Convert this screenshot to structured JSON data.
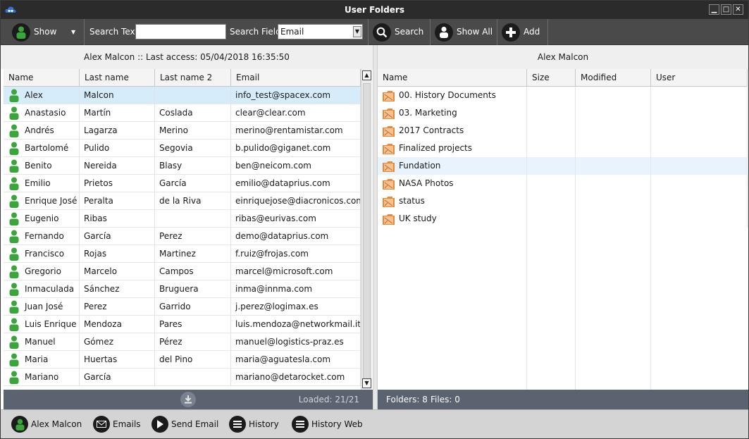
{
  "window": {
    "title": "User Folders"
  },
  "toolbar": {
    "show_label": "Show",
    "search_text_label": "Search Text",
    "search_text_value": "",
    "search_field_label": "Search Field",
    "search_field_value": "Email",
    "search_label": "Search",
    "show_all_label": "Show All",
    "add_label": "Add"
  },
  "left_pane": {
    "header": "Alex Malcon :: Last access: 05/04/2018 16:35:50",
    "columns": [
      "Name",
      "Last name",
      "Last name 2",
      "Email"
    ],
    "rows": [
      {
        "name": "Alex",
        "last": "Malcon",
        "last2": "",
        "email": "info_test@spacex.com"
      },
      {
        "name": "Anastasio",
        "last": "Martín",
        "last2": "Coslada",
        "email": "clear@clear.com"
      },
      {
        "name": "Andrés",
        "last": "Lagarza",
        "last2": "Merino",
        "email": "merino@rentamistar.com"
      },
      {
        "name": "Bartolomé",
        "last": "Pulido",
        "last2": "Segovia",
        "email": "b.pulido@giganet.com"
      },
      {
        "name": "Benito",
        "last": "Nereida",
        "last2": "Blasy",
        "email": "ben@neicom.com"
      },
      {
        "name": "Emilio",
        "last": "Prietos",
        "last2": "García",
        "email": "emilio@dataprius.com"
      },
      {
        "name": "Enrique José",
        "last": "Peralta",
        "last2": "de la Riva",
        "email": "einriquejose@diacronicos.com"
      },
      {
        "name": "Eugenio",
        "last": "Ribas",
        "last2": "",
        "email": "ribas@eurivas.com"
      },
      {
        "name": "Fernando",
        "last": "García",
        "last2": "Perez",
        "email": "demo@dataprius.com"
      },
      {
        "name": "Francisco",
        "last": "Rojas",
        "last2": "Martinez",
        "email": "f.ruiz@frojas.com"
      },
      {
        "name": "Gregorio",
        "last": "Marcelo",
        "last2": "Campos",
        "email": "marcel@microsoft.com"
      },
      {
        "name": "Inmaculada",
        "last": "Sánchez",
        "last2": "Bruguera",
        "email": "inma@innma.com"
      },
      {
        "name": "Juan José",
        "last": "Perez",
        "last2": "Garrido",
        "email": "j.perez@logimax.es"
      },
      {
        "name": "Luis Enrique",
        "last": "Mendoza",
        "last2": "Pares",
        "email": "luis.mendoza@networkmail.it"
      },
      {
        "name": "Manuel",
        "last": "Gómez",
        "last2": "Pérez",
        "email": "manuel@logistics-praz.es"
      },
      {
        "name": "Maria",
        "last": "Huertas",
        "last2": "del Pino",
        "email": "maria@aguatesla.com"
      },
      {
        "name": "Mariano",
        "last": "García",
        "last2": "",
        "email": "mariano@detarocket.com"
      }
    ],
    "footer_loaded": "Loaded: 21/21"
  },
  "right_pane": {
    "header": "Alex Malcon",
    "columns": [
      "Name",
      "Size",
      "Modified",
      "User"
    ],
    "folders": [
      "00. History Documents",
      "03. Marketing",
      "2017 Contracts",
      "Finalized projects",
      "Fundation",
      "NASA Photos",
      "status",
      "UK study"
    ],
    "footer_folders": "Folders: 8",
    "footer_files": "Files: 0"
  },
  "bottom_bar": {
    "user_label": "Alex Malcon",
    "emails_label": "Emails",
    "send_email_label": "Send Email",
    "history_label": "History",
    "history_web_label": "History Web"
  },
  "icons": {
    "app": "cloud-logo-icon",
    "user": "person-icon",
    "folder": "folder-icon",
    "search": "magnifier-icon",
    "add": "plus-icon",
    "download": "download-icon"
  },
  "colors": {
    "selected_row": "#d7ecfb",
    "person_green": "#3aa53a",
    "folder_orange": "#e8893a",
    "footer_bg": "#5b6270",
    "toolbar_bg": "#4a4a4a"
  }
}
